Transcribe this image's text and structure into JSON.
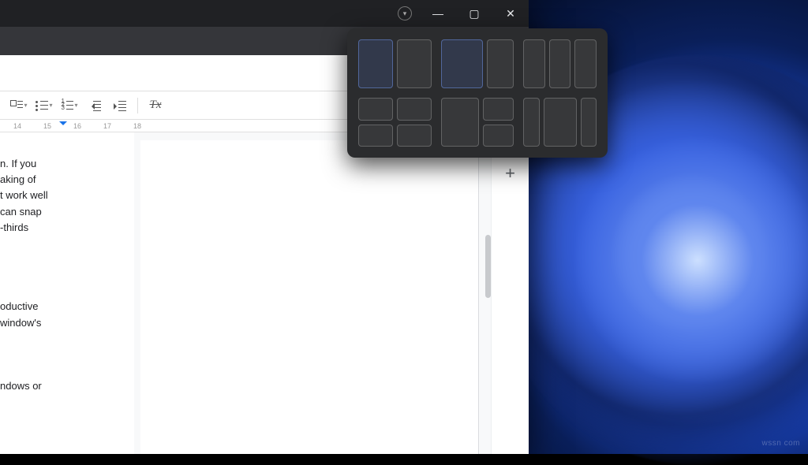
{
  "window_controls": {
    "minimize": "—",
    "maximize": "▢",
    "close": "✕",
    "dot": "▾"
  },
  "urlbar_icons": {
    "star": "☆",
    "reader": "▤",
    "tabs": "❐"
  },
  "toolbar": {
    "checklist_dd": "▾",
    "bullets_dd": "▾",
    "numbers_dd": "▾",
    "clear_format": "Tx"
  },
  "ruler": {
    "marks": [
      "14",
      "15",
      "16",
      "17",
      "18"
    ]
  },
  "doc_text_1": "n. If you\naking of\nt work well\ncan snap\n-thirds",
  "doc_text_2": "oductive\nwindow's",
  "doc_text_3": "ndows or",
  "side": {
    "keep": "keep-icon",
    "tasks": "tasks-icon",
    "add": "+"
  },
  "watermark": "wssn com"
}
